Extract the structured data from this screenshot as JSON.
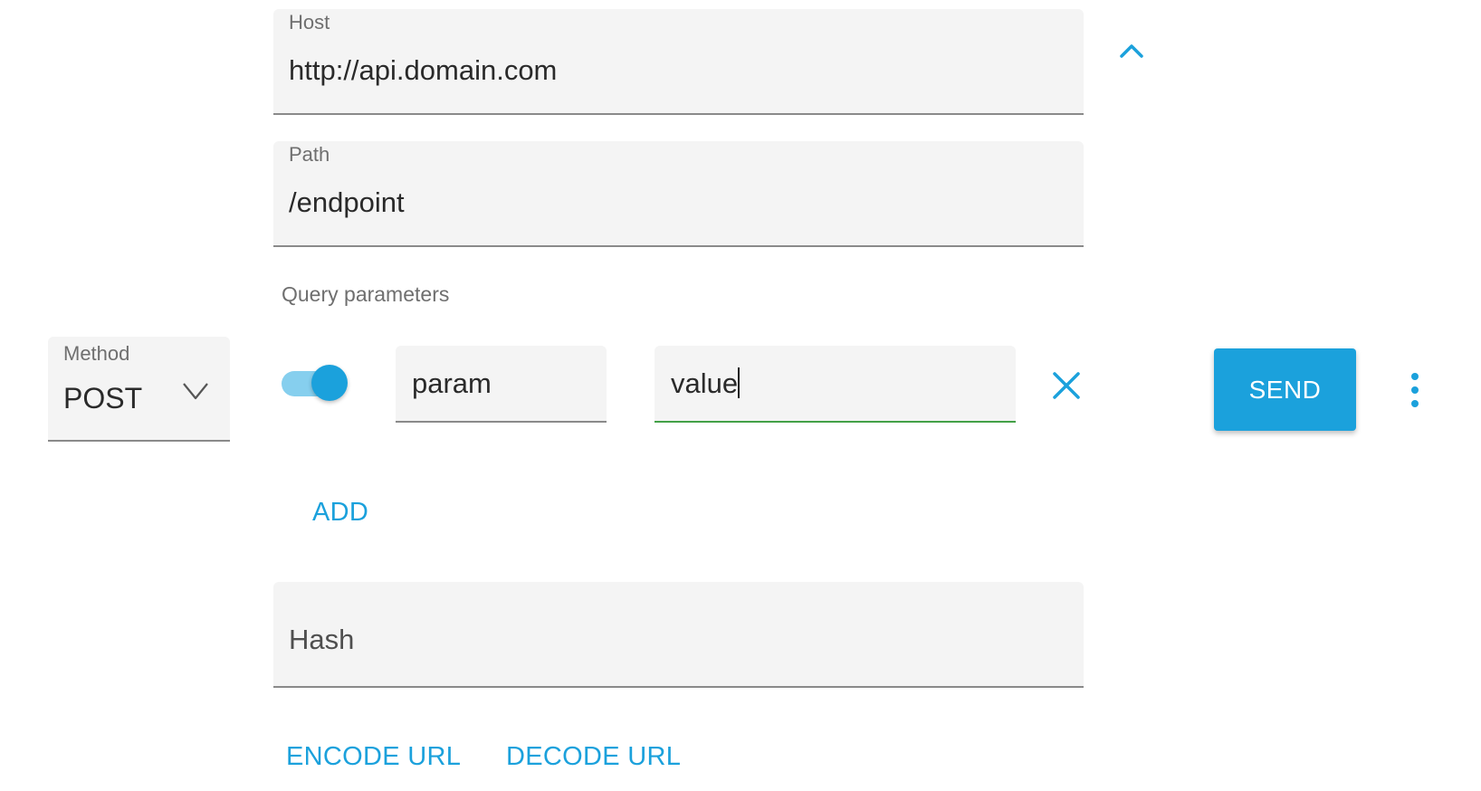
{
  "host": {
    "label": "Host",
    "value": "http://api.domain.com"
  },
  "path": {
    "label": "Path",
    "value": "/endpoint"
  },
  "query": {
    "section_label": "Query parameters",
    "params": [
      {
        "enabled": true,
        "name": "param",
        "value": "value"
      }
    ],
    "add_label": "ADD"
  },
  "method": {
    "label": "Method",
    "value": "POST"
  },
  "hash": {
    "placeholder": "Hash"
  },
  "actions": {
    "send_label": "SEND",
    "encode_label": "ENCODE URL",
    "decode_label": "DECODE URL"
  },
  "icons": {
    "collapse": "chevron-up-icon",
    "dropdown": "chevron-down-icon",
    "remove": "close-icon",
    "more": "more-vert-icon"
  },
  "colors": {
    "accent": "#1ba1dc",
    "toggle_track": "#86cfee",
    "active_underline": "#43a047",
    "field_background": "#f4f4f4"
  }
}
